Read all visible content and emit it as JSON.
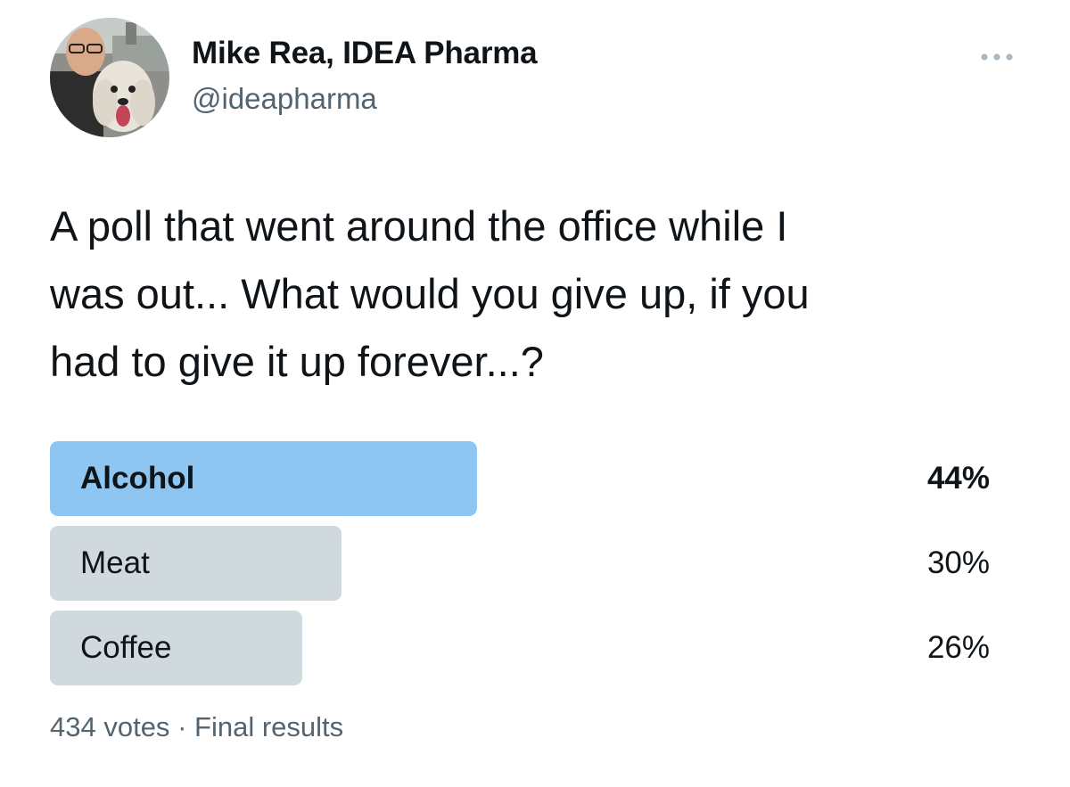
{
  "author": {
    "name": "Mike Rea, IDEA Pharma",
    "handle": "@ideapharma",
    "avatar_icon": "profile-photo-man-with-dog"
  },
  "menu": {
    "icon": "more-horizontal-icon"
  },
  "tweet": {
    "lines": [
      "A poll that went around the office while I",
      "was out... What would you give up, if you",
      "had to give it up forever...?"
    ]
  },
  "poll": {
    "options": [
      {
        "label": "Alcohol",
        "percent_text": "44%",
        "percent": 44,
        "winner": true
      },
      {
        "label": "Meat",
        "percent_text": "30%",
        "percent": 30,
        "winner": false
      },
      {
        "label": "Coffee",
        "percent_text": "26%",
        "percent": 26,
        "winner": false
      }
    ],
    "votes": "434 votes",
    "separator": "·",
    "status": "Final results"
  },
  "colors": {
    "winner_bar": "#8ec6f1",
    "bar": "#cfd9de",
    "text": "#0f1419",
    "secondary_text": "#536471"
  }
}
